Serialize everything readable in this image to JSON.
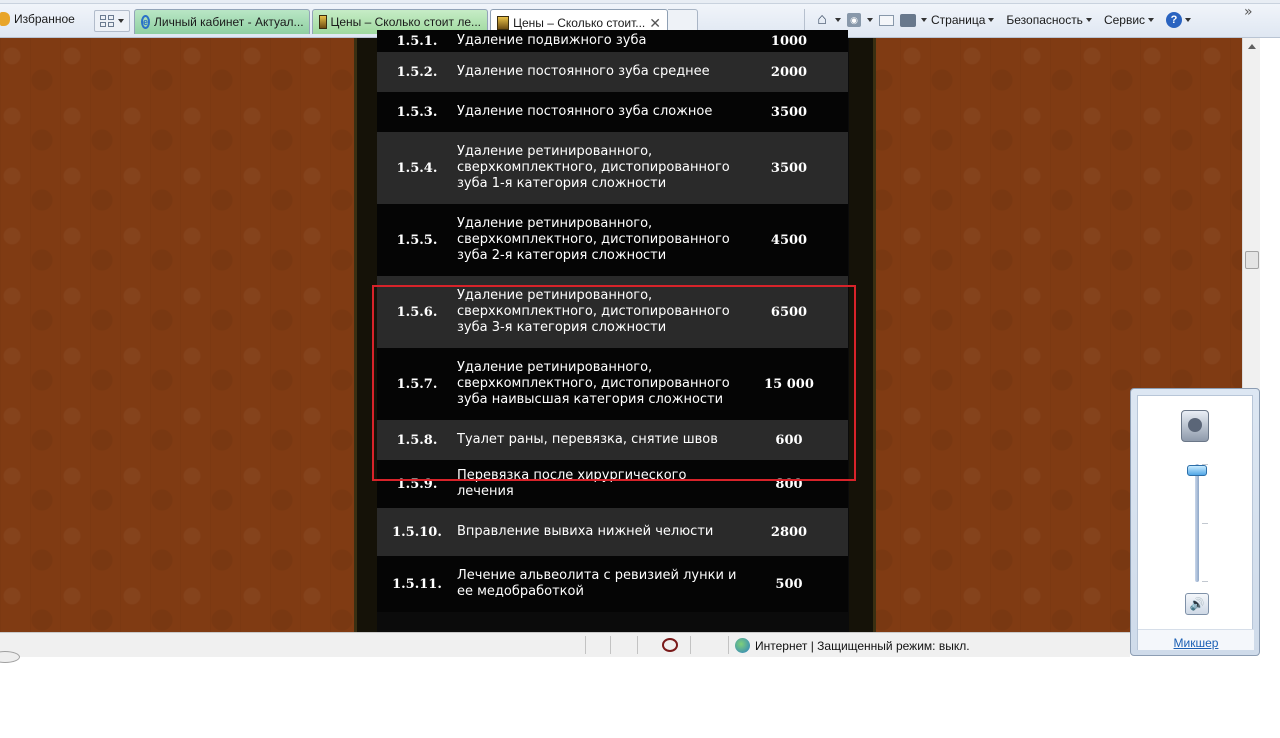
{
  "toolbar": {
    "favorites_label": "Избранное",
    "tabs": [
      {
        "title": "Личный кабинет - Актуал..."
      },
      {
        "title": "Цены – Сколько стоит ле..."
      },
      {
        "title": "Цены – Сколько стоит..."
      }
    ],
    "menu": {
      "page": "Страница",
      "safety": "Безопасность",
      "tools": "Сервис"
    }
  },
  "price_list": {
    "rows": [
      {
        "code": "1.5.1.",
        "name": "Удаление подвижного зуба",
        "price": "1000"
      },
      {
        "code": "1.5.2.",
        "name": "Удаление постоянного зуба среднее",
        "price": "2000"
      },
      {
        "code": "1.5.3.",
        "name": "Удаление постоянного зуба сложное",
        "price": "3500"
      },
      {
        "code": "1.5.4.",
        "name": "Удаление ретинированного, сверхкомплектного, дистопированного зуба 1-я категория сложности",
        "price": "3500"
      },
      {
        "code": "1.5.5.",
        "name": "Удаление ретинированного, сверхкомплектного, дистопированного зуба 2-я категория сложности",
        "price": "4500"
      },
      {
        "code": "1.5.6.",
        "name": "Удаление ретинированного, сверхкомплектного, дистопированного зуба 3-я категория сложности",
        "price": "6500"
      },
      {
        "code": "1.5.7.",
        "name": "Удаление ретинированного, сверхкомплектного, дистопированного зуба наивысшая категория сложности",
        "price": "15 000"
      },
      {
        "code": "1.5.8.",
        "name": "Туалет раны, перевязка, снятие швов",
        "price": "600"
      },
      {
        "code": "1.5.9.",
        "name": "Перевязка после хирургического лечения",
        "price": "800"
      },
      {
        "code": "1.5.10.",
        "name": "Вправление вывиха нижней челюсти",
        "price": "2800"
      },
      {
        "code": "1.5.11.",
        "name": "Лечение альвеолита с ревизией лунки и ее медобработкой",
        "price": "500"
      }
    ]
  },
  "statusbar": {
    "zone_text": "Интернет | Защищенный режим: выкл."
  },
  "volume_popup": {
    "mixer_label": "Микшер",
    "level_fraction": 0.95
  },
  "colors": {
    "highlight": "#d8232a",
    "page_background": "#803b13",
    "row_odd": "#2a2a2a",
    "row_even": "#050505"
  }
}
